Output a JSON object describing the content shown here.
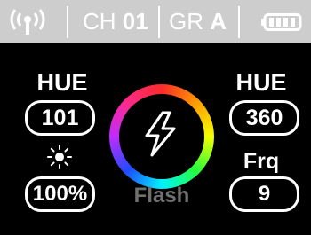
{
  "status": {
    "signal_icon": "wireless-signal-icon",
    "channel_label": "CH",
    "channel_value": "01",
    "group_label": "GR",
    "group_value": "A",
    "battery_icon": "battery-icon",
    "battery_level": 1.0
  },
  "left": {
    "hue_label": "HUE",
    "hue_value": "101",
    "brightness_icon": "sun-icon",
    "brightness_value": "100%"
  },
  "center": {
    "effect_icon": "lightning-bolt-icon",
    "mode_label": "Flash"
  },
  "right": {
    "hue_label": "HUE",
    "hue_value": "360",
    "frequency_label": "Frq",
    "frequency_value": "9"
  },
  "colors": {
    "status_bar": "#cdcdcd",
    "screen_background": "#000000",
    "text": "#ffffff",
    "mode_label": "#6f6f6f"
  }
}
